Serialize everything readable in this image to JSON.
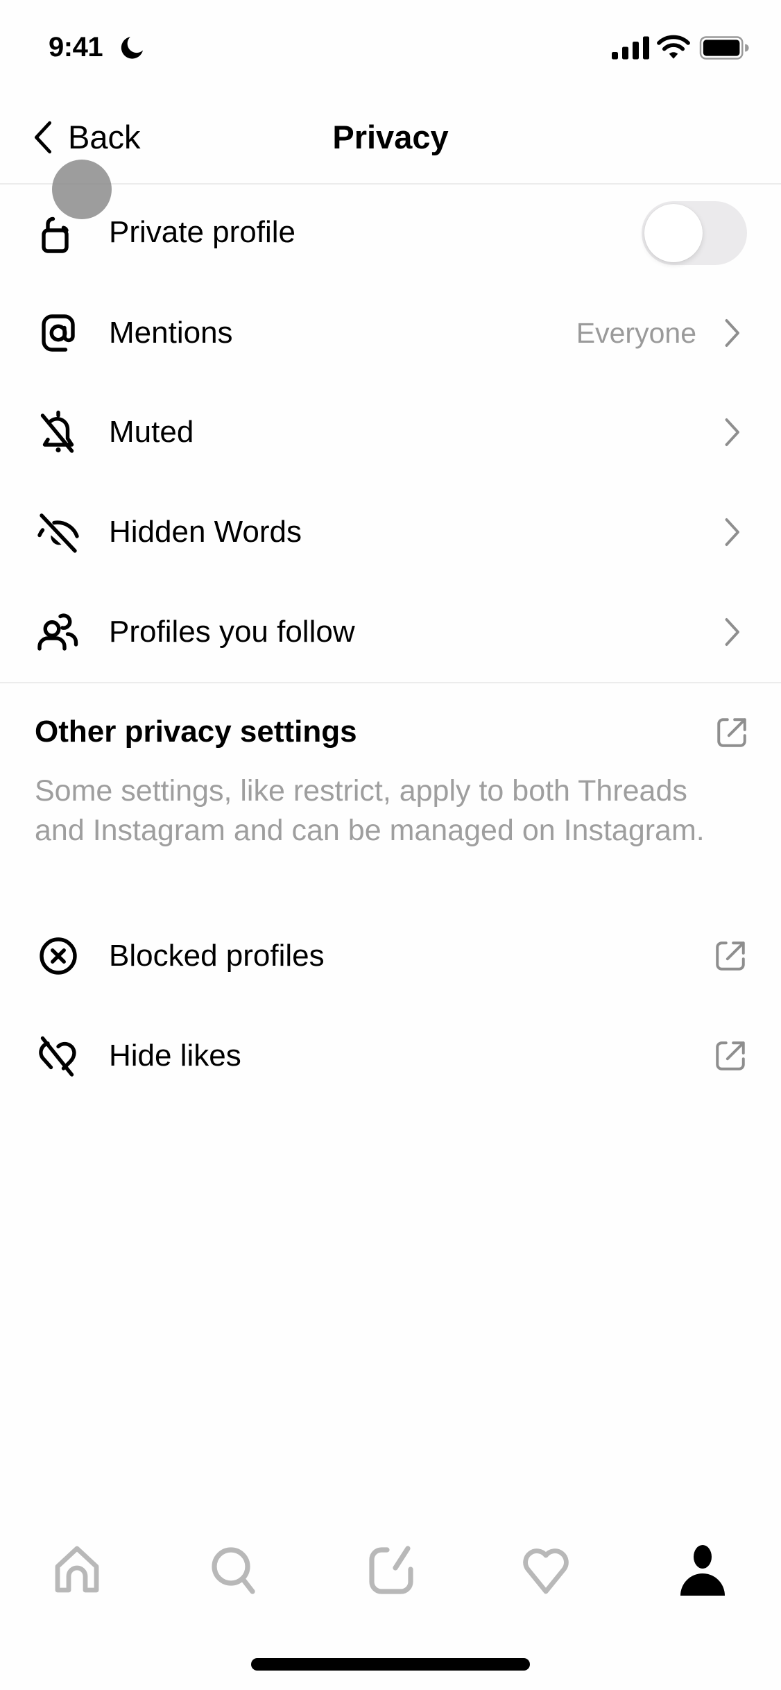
{
  "status_bar": {
    "time": "9:41",
    "icons": [
      "moon-icon",
      "signal-icon",
      "wifi-icon",
      "battery-icon"
    ]
  },
  "nav": {
    "back_label": "Back",
    "title": "Privacy"
  },
  "settings": [
    {
      "label": "Private profile",
      "icon": "lock-open-icon",
      "control": "toggle",
      "toggle_on": false
    },
    {
      "label": "Mentions",
      "icon": "at-sign-icon",
      "value": "Everyone",
      "control": "chevron"
    },
    {
      "label": "Muted",
      "icon": "bell-off-icon",
      "control": "chevron"
    },
    {
      "label": "Hidden Words",
      "icon": "eye-off-icon",
      "control": "chevron"
    },
    {
      "label": "Profiles you follow",
      "icon": "users-icon",
      "control": "chevron"
    }
  ],
  "other_section": {
    "title": "Other privacy settings",
    "description": "Some settings, like restrict, apply to both Threads and Instagram and can be managed on Instagram.",
    "items": [
      {
        "label": "Blocked profiles",
        "icon": "block-circle-icon",
        "control": "external-link"
      },
      {
        "label": "Hide likes",
        "icon": "heart-off-icon",
        "control": "external-link"
      }
    ]
  },
  "tab_bar": {
    "tabs": [
      {
        "name": "home",
        "icon": "home-icon",
        "active": false
      },
      {
        "name": "search",
        "icon": "search-icon",
        "active": false
      },
      {
        "name": "compose",
        "icon": "compose-icon",
        "active": false
      },
      {
        "name": "activity",
        "icon": "heart-icon",
        "active": false
      },
      {
        "name": "profile",
        "icon": "profile-icon",
        "active": true
      }
    ]
  },
  "colors": {
    "text_primary": "#000000",
    "text_secondary": "#9a9a9a",
    "tab_inactive": "#b8b8b8",
    "toggle_off": "#ebeaec",
    "divider": "#ececec"
  }
}
